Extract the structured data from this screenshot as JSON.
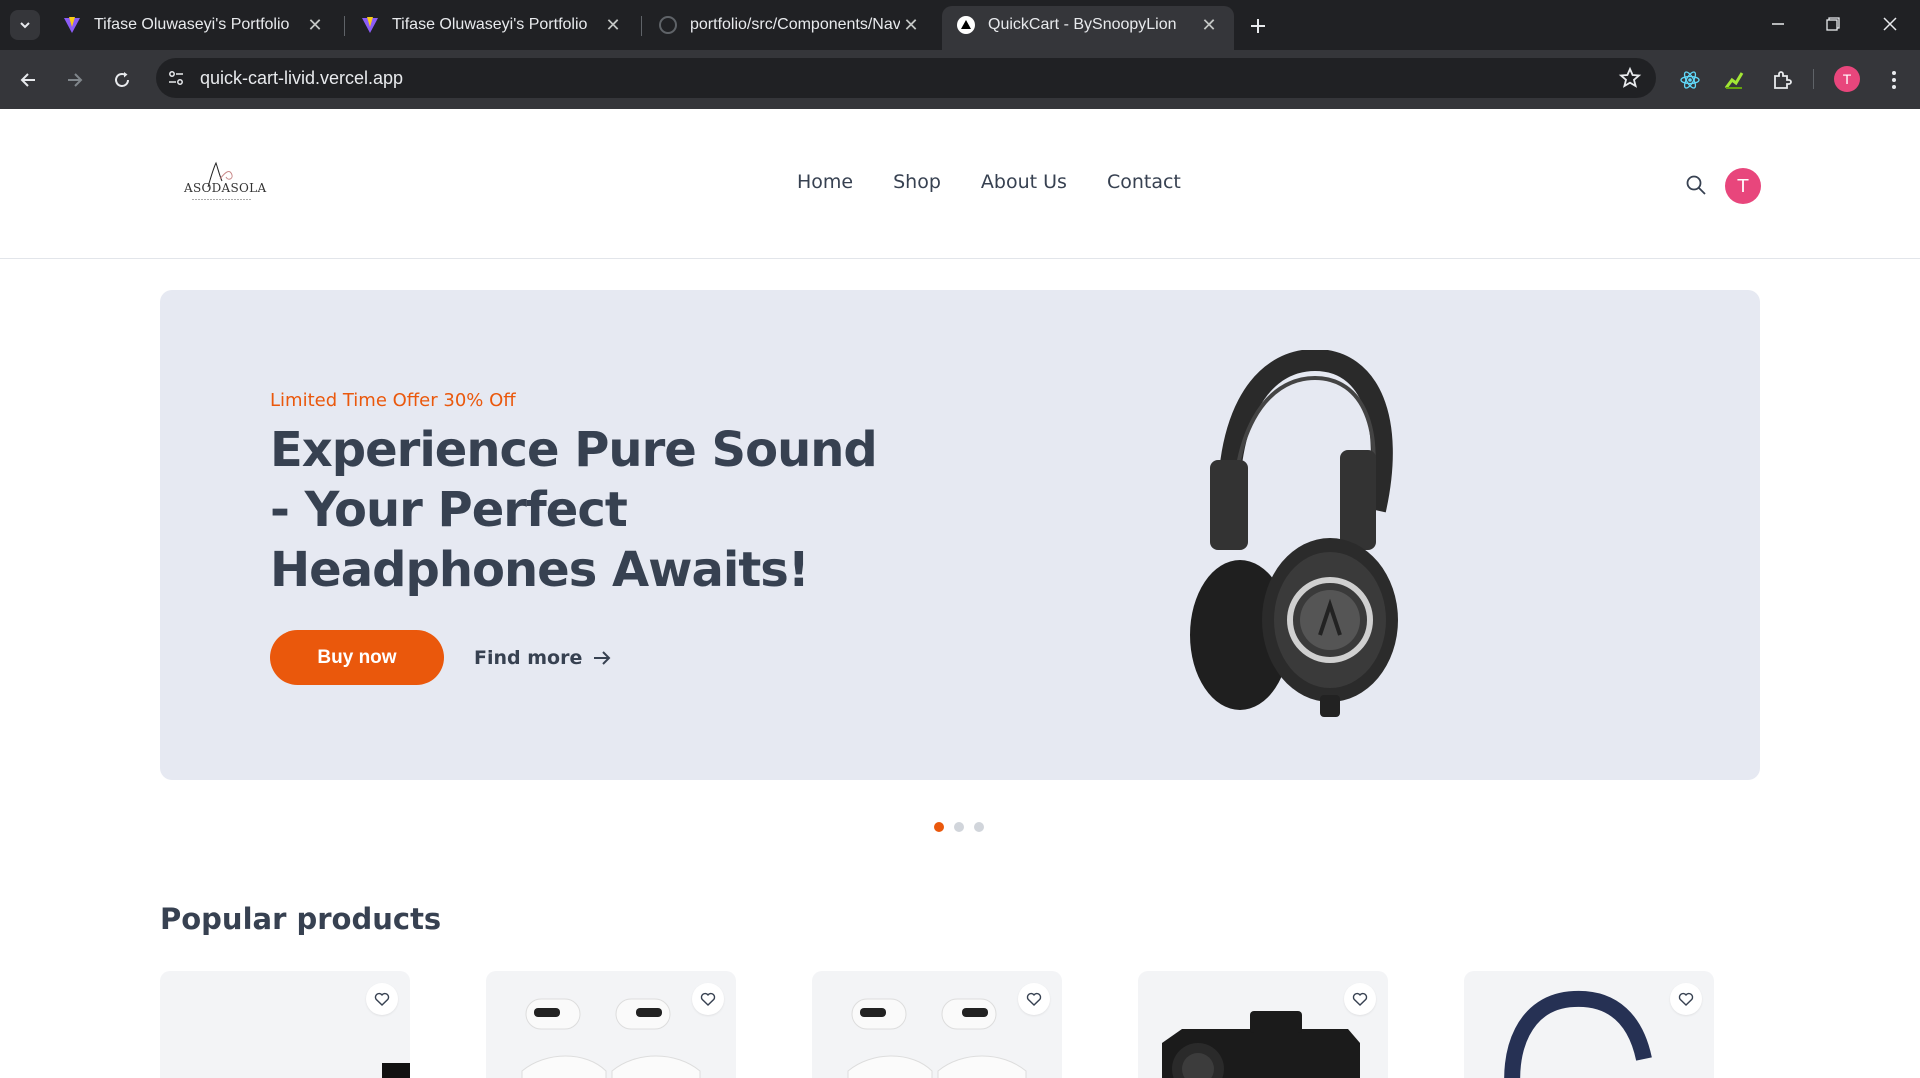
{
  "browser": {
    "tabs": [
      {
        "title": "Tifase Oluwaseyi's Portfolio",
        "active": false
      },
      {
        "title": "Tifase Oluwaseyi's Portfolio",
        "active": false
      },
      {
        "title": "portfolio/src/Components/Navi",
        "active": false
      },
      {
        "title": "QuickCart - BySnoopyLion",
        "active": true
      }
    ],
    "url": "quick-cart-livid.vercel.app",
    "profile_initial": "T"
  },
  "site": {
    "logo_text": "ASODASOLA",
    "nav": [
      "Home",
      "Shop",
      "About Us",
      "Contact"
    ],
    "user_initial": "T"
  },
  "hero": {
    "offer": "Limited Time Offer 30% Off",
    "title": "Experience Pure Sound - Your Perfect Headphones Awaits!",
    "buy_label": "Buy now",
    "more_label": "Find more",
    "slide_count": 3,
    "active_slide": 1
  },
  "popular": {
    "title": "Popular products",
    "products": [
      {
        "image": "product-image"
      },
      {
        "image": "airpods-image"
      },
      {
        "image": "airpods-image"
      },
      {
        "image": "camera-image"
      },
      {
        "image": "headphones-image"
      }
    ]
  },
  "colors": {
    "accent": "#ea580c",
    "hero_bg": "#e6e9f2",
    "avatar": "#e8467c",
    "text": "#374151"
  }
}
